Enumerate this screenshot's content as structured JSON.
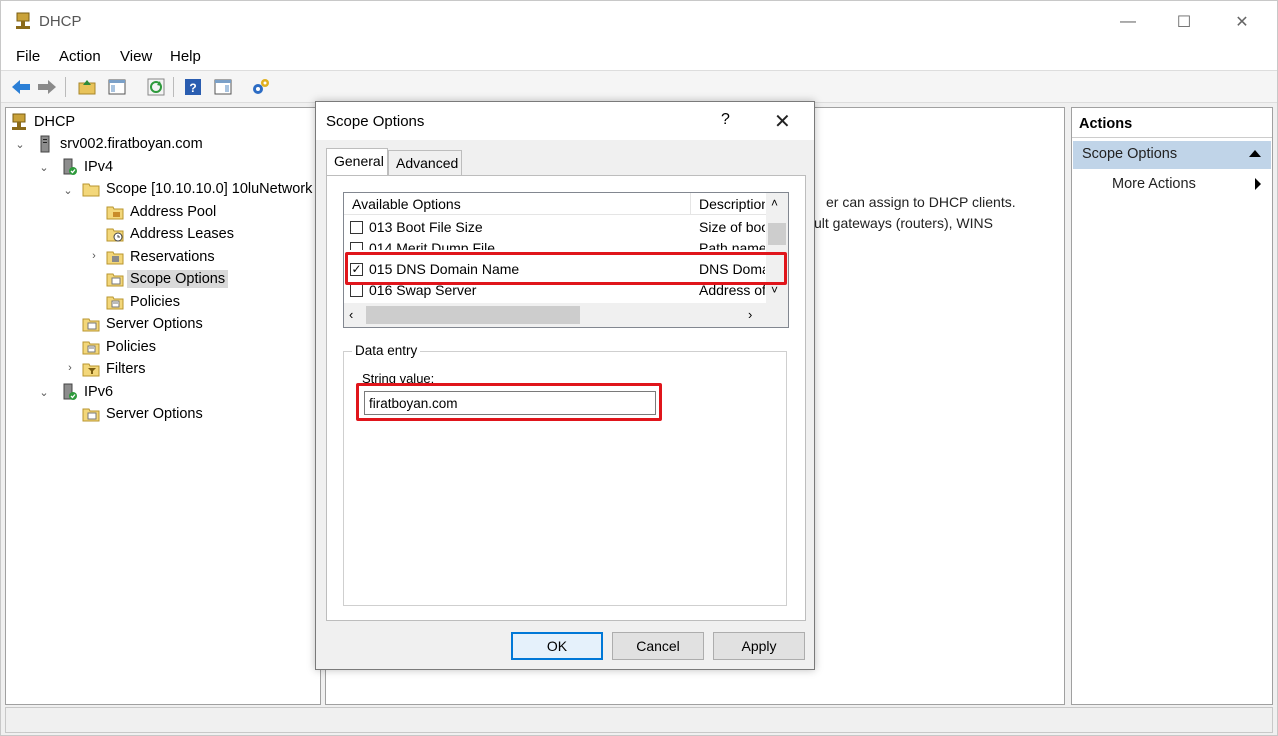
{
  "window": {
    "title": "DHCP",
    "minimize": "—",
    "maximize": "☐",
    "close": "✕"
  },
  "menu": {
    "file": "File",
    "action": "Action",
    "view": "View",
    "help": "Help"
  },
  "tree": {
    "root": "DHCP",
    "server": "srv002.firatboyan.com",
    "ipv4": "IPv4",
    "scope": "Scope [10.10.10.0] 10luNetwork",
    "address_pool": "Address Pool",
    "address_leases": "Address Leases",
    "reservations": "Reservations",
    "scope_options": "Scope Options",
    "scope_policies": "Policies",
    "server_options": "Server Options",
    "policies": "Policies",
    "filters": "Filters",
    "ipv6": "IPv6",
    "ipv6_server_options": "Server Options"
  },
  "center": {
    "line1": "er can assign to DHCP clients.",
    "line2": "ult gateways (routers), WINS"
  },
  "actions": {
    "header": "Actions",
    "section": "Scope Options",
    "more_actions": "More Actions"
  },
  "dialog": {
    "title": "Scope Options",
    "help": "?",
    "close": "✕",
    "tabs": {
      "general": "General",
      "advanced": "Advanced"
    },
    "list": {
      "col_available": "Available Options",
      "col_description": "Description",
      "rows": [
        {
          "name": "013 Boot File Size",
          "desc": "Size of boot",
          "checked": false
        },
        {
          "name": "014 Merit Dump File",
          "desc": "Path name",
          "checked": false
        },
        {
          "name": "015 DNS Domain Name",
          "desc": "DNS Domain",
          "checked": true
        },
        {
          "name": "016 Swap Server",
          "desc": "Address of",
          "checked": false
        }
      ]
    },
    "data_entry": {
      "group_label": "Data entry",
      "string_label": "String value:",
      "string_value": "firatboyan.com"
    },
    "buttons": {
      "ok": "OK",
      "cancel": "Cancel",
      "apply": "Apply"
    }
  },
  "colors": {
    "highlight": "#e0151b",
    "selection": "#c0d4e8",
    "default_button_border": "#0078d7"
  }
}
